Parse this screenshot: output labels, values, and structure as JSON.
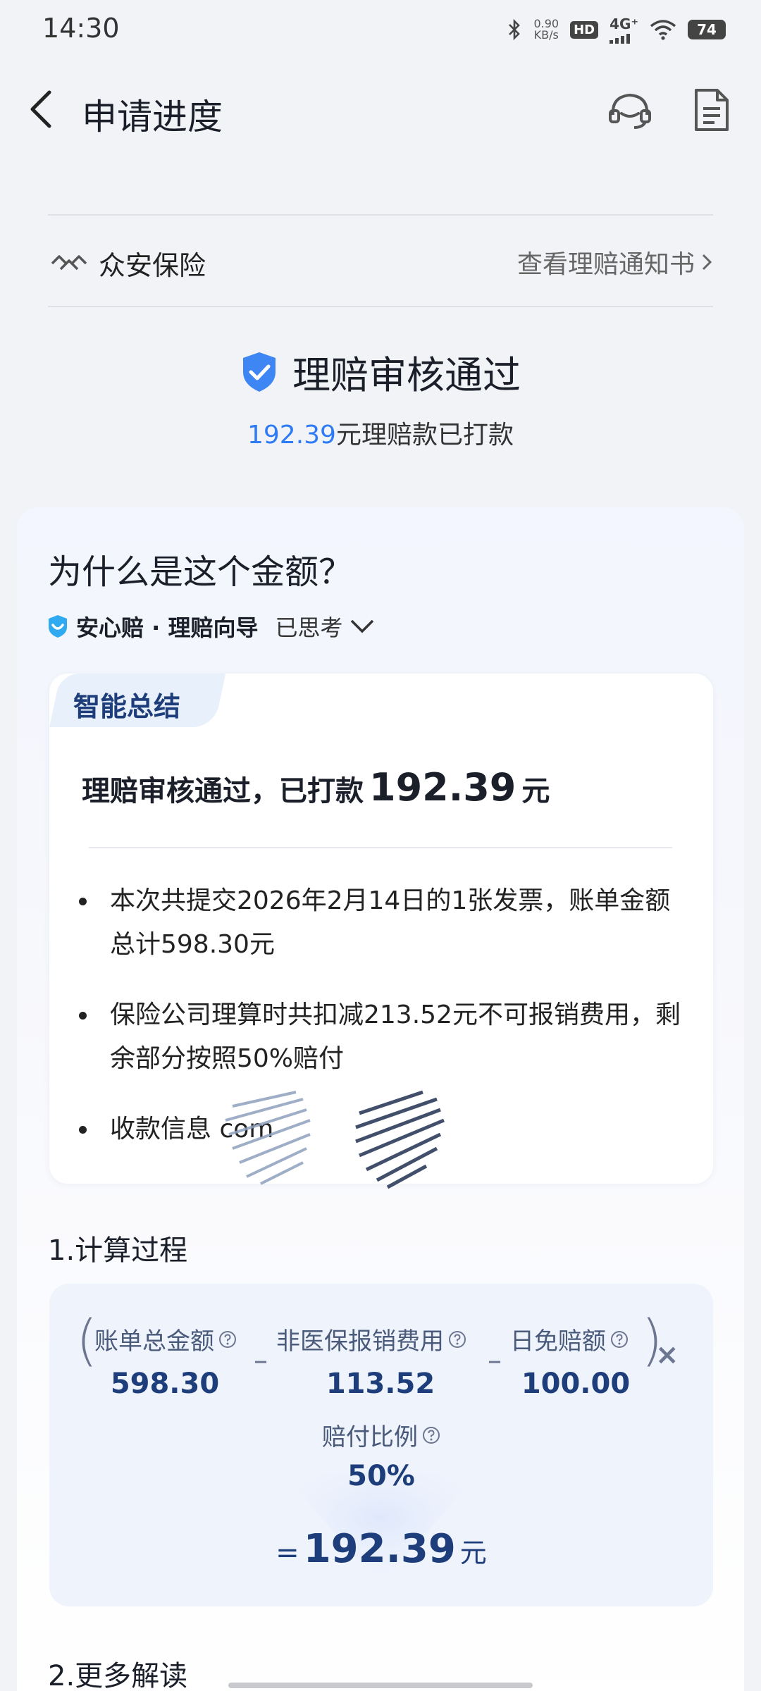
{
  "status_bar": {
    "time": "14:30",
    "net_speed_value": "0.90",
    "net_speed_unit": "KB/s",
    "hd": "HD",
    "network": "4G⁺",
    "battery": "74",
    "icons": [
      "bluetooth-icon",
      "signal-icon",
      "wifi-icon",
      "battery-icon"
    ]
  },
  "nav": {
    "title": "申请进度",
    "icons": [
      "back-icon",
      "customer-service-icon",
      "document-icon"
    ]
  },
  "insurer": {
    "name": "众安保险",
    "notice_link": "查看理赔通知书"
  },
  "approval": {
    "title": "理赔审核通过",
    "paid_amount": "192.39",
    "paid_text": "元理赔款已打款"
  },
  "explain": {
    "title": "为什么是这个金额？",
    "guide_brand": "安心赔 · 理赔向导",
    "guide_state": "已思考"
  },
  "summary": {
    "tab_label": "智能总结",
    "headline_text": "理赔审核通过，已打款",
    "headline_amount": "192.39",
    "headline_unit": "元",
    "bullets": [
      "本次共提交2026年2月14日的1张发票，账单金额总计598.30元",
      "保险公司理算时共扣减213.52元不可报销费用，剩余部分按照50%赔付",
      "收款信息 com"
    ]
  },
  "calc": {
    "section_title": "1.计算过程",
    "terms": [
      {
        "label": "账单总金额",
        "value": "598.30"
      },
      {
        "label": "非医保报销费用",
        "value": "113.52"
      },
      {
        "label": "日免赔额",
        "value": "100.00"
      }
    ],
    "minus": "–",
    "times": "×",
    "ratio_label": "赔付比例",
    "ratio_value": "50%",
    "equals": "=",
    "result_value": "192.39",
    "result_unit": "元"
  },
  "more": {
    "section_title": "2.更多解读"
  },
  "colors": {
    "accent_blue": "#2f7bf6",
    "navy": "#1d3e7a",
    "background": "#f2f3f7"
  }
}
